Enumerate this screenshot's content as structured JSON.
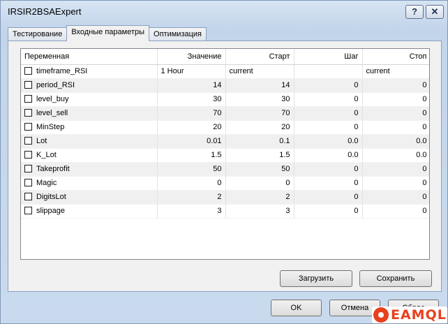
{
  "window": {
    "title": "IRSIR2BSAExpert",
    "help_label": "?",
    "close_label": "✕"
  },
  "tabs": [
    "Тестирование",
    "Входные параметры",
    "Оптимизация"
  ],
  "table": {
    "columns": [
      "Переменная",
      "Значение",
      "Старт",
      "Шаг",
      "Стоп"
    ],
    "rows": [
      {
        "name": "timeframe_RSI",
        "value": "1 Hour",
        "start": "current",
        "step": "",
        "stop": "current"
      },
      {
        "name": "period_RSI",
        "value": "14",
        "start": "14",
        "step": "0",
        "stop": "0"
      },
      {
        "name": "level_buy",
        "value": "30",
        "start": "30",
        "step": "0",
        "stop": "0"
      },
      {
        "name": "level_sell",
        "value": "70",
        "start": "70",
        "step": "0",
        "stop": "0"
      },
      {
        "name": "MinStep",
        "value": "20",
        "start": "20",
        "step": "0",
        "stop": "0"
      },
      {
        "name": "Lot",
        "value": "0.01",
        "start": "0.1",
        "step": "0.0",
        "stop": "0.0"
      },
      {
        "name": "K_Lot",
        "value": "1.5",
        "start": "1.5",
        "step": "0.0",
        "stop": "0.0"
      },
      {
        "name": "Takeprofit",
        "value": "50",
        "start": "50",
        "step": "0",
        "stop": "0"
      },
      {
        "name": "Magic",
        "value": "0",
        "start": "0",
        "step": "0",
        "stop": "0"
      },
      {
        "name": "DigitsLot",
        "value": "2",
        "start": "2",
        "step": "0",
        "stop": "0"
      },
      {
        "name": "slippage",
        "value": "3",
        "start": "3",
        "step": "0",
        "stop": "0"
      }
    ]
  },
  "buttons": {
    "load": "Загрузить",
    "save": "Сохранить",
    "ok": "OK",
    "cancel": "Отмена",
    "reset": "Сброс"
  },
  "watermark": "EAMQL"
}
